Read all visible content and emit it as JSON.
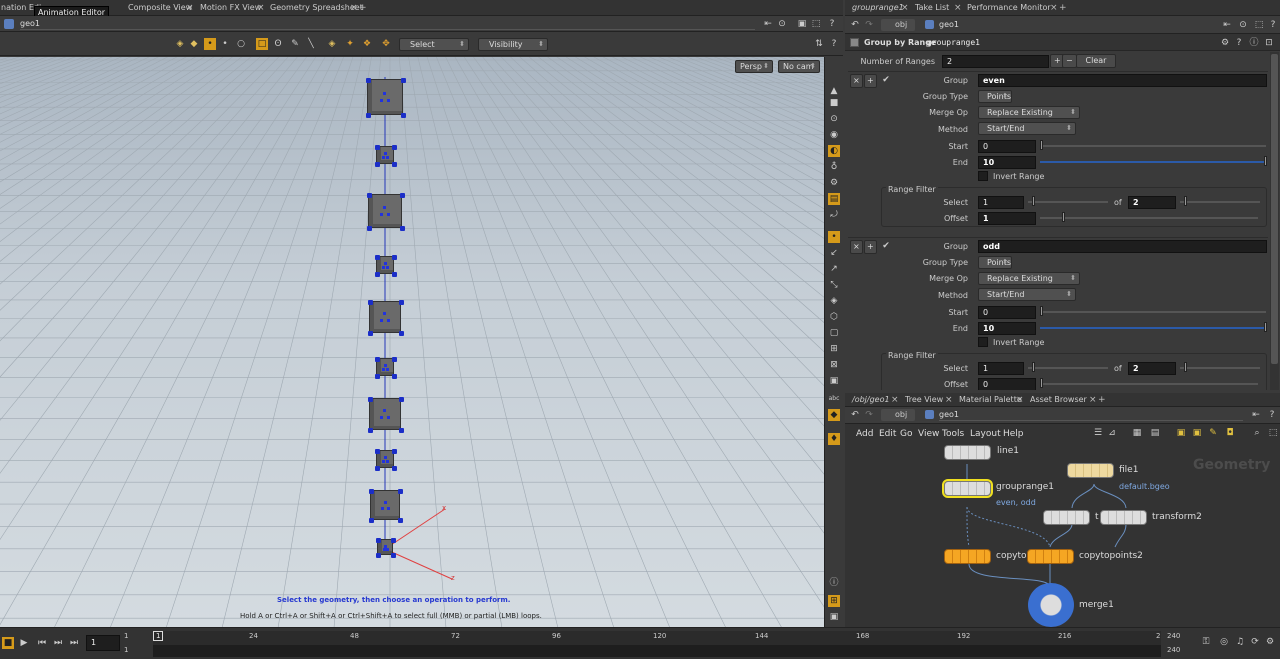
{
  "left_tabs": [
    "nation Edi",
    "Composite View",
    "Motion FX View",
    "Geometry Spreadsheet"
  ],
  "tooltip": "Animation Editor",
  "left_path": "geo1",
  "viewport": {
    "select_label": "Select",
    "visibility_label": "Visibility",
    "persp": "Persp",
    "nocam": "No cam",
    "hint1": "Select the geometry, then choose an operation to perform.",
    "hint2": "Hold A or Ctrl+A or Shift+A or Ctrl+Shift+A to select full (MMB) or partial (LMB) loops.",
    "axis_x": "x",
    "axis_z": "z"
  },
  "right_tabs": [
    "grouprange1",
    "Take List",
    "Performance Monitor"
  ],
  "right_path": {
    "obj": "obj",
    "geo": "geo1"
  },
  "params": {
    "node_type": "Group by Range",
    "node_name": "grouprange1",
    "num_ranges_label": "Number of Ranges",
    "num_ranges": "2",
    "clear": "Clear",
    "blocks": [
      {
        "group_label": "Group",
        "group": "even",
        "group_type_label": "Group Type",
        "group_type": "Points",
        "merge_op_label": "Merge Op",
        "merge_op": "Replace Existing",
        "method_label": "Method",
        "method": "Start/End",
        "start_label": "Start",
        "start": "0",
        "end_label": "End",
        "end": "10",
        "invert": "Invert Range",
        "filter": "Range Filter",
        "select_label": "Select",
        "select": "1",
        "of": "of",
        "of_val": "2",
        "offset_label": "Offset",
        "offset": "1"
      },
      {
        "group_label": "Group",
        "group": "odd",
        "group_type_label": "Group Type",
        "group_type": "Points",
        "merge_op_label": "Merge Op",
        "merge_op": "Replace Existing",
        "method_label": "Method",
        "method": "Start/End",
        "start_label": "Start",
        "start": "0",
        "end_label": "End",
        "end": "10",
        "invert": "Invert Range",
        "filter": "Range Filter",
        "select_label": "Select",
        "select": "1",
        "of": "of",
        "of_val": "2",
        "offset_label": "Offset",
        "offset": "0"
      }
    ]
  },
  "net_tabs": [
    "/obj/geo1",
    "Tree View",
    "Material Palette",
    "Asset Browser"
  ],
  "net_path": {
    "obj": "obj",
    "geo": "geo1"
  },
  "net_menu": [
    "Add",
    "Edit",
    "Go",
    "View",
    "Tools",
    "Layout",
    "Help"
  ],
  "net_watermark": "Geometry",
  "nodes": {
    "line1": "line1",
    "file1": "file1",
    "file1_sub": "default.bgeo",
    "grouprange1": "grouprange1",
    "grouprange1_sub": "even, odd",
    "transform_a": "t",
    "transform2": "transform2",
    "copytopoints_a": "copyto",
    "copytopoints2": "copytopoints2",
    "merge1": "merge1"
  },
  "timeline": {
    "frame": "1",
    "start1": "1",
    "start2": "1",
    "marker": "1",
    "ticks": [
      "24",
      "48",
      "72",
      "96",
      "120",
      "144",
      "168",
      "192",
      "216",
      "2"
    ],
    "end1": "240",
    "end2": "240"
  }
}
